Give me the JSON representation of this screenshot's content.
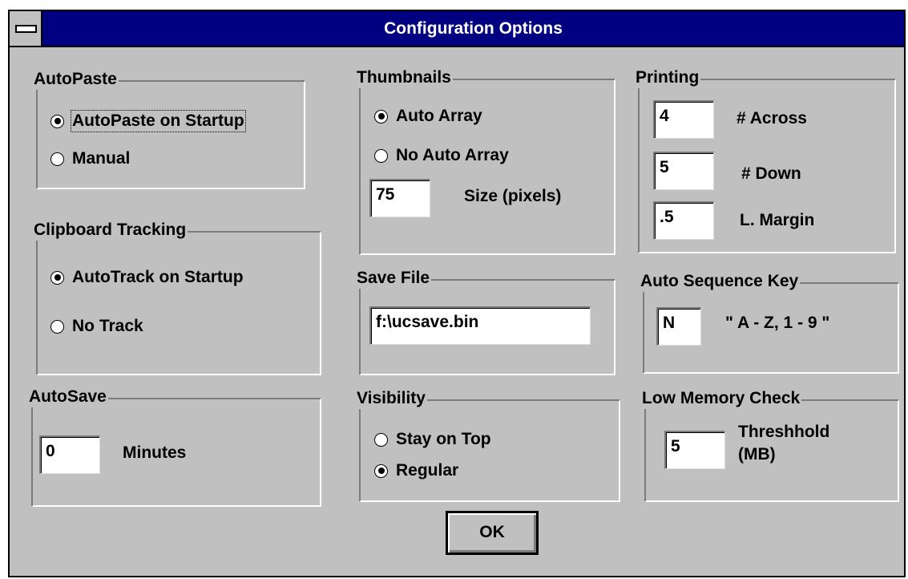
{
  "window": {
    "title": "Configuration Options"
  },
  "autopaste": {
    "legend": "AutoPaste",
    "options": [
      {
        "label": "AutoPaste on Startup",
        "selected": true
      },
      {
        "label": "Manual",
        "selected": false
      }
    ]
  },
  "clipboard": {
    "legend": "Clipboard Tracking",
    "options": [
      {
        "label": "AutoTrack on Startup",
        "selected": true
      },
      {
        "label": "No Track",
        "selected": false
      }
    ]
  },
  "autosave": {
    "legend": "AutoSave",
    "value": "0",
    "unit_label": "Minutes"
  },
  "thumbnails": {
    "legend": "Thumbnails",
    "options": [
      {
        "label": "Auto Array",
        "selected": true
      },
      {
        "label": "No Auto Array",
        "selected": false
      }
    ],
    "size_value": "75",
    "size_label": "Size (pixels)"
  },
  "savefile": {
    "legend": "Save File",
    "value": "f:\\ucsave.bin"
  },
  "visibility": {
    "legend": "Visibility",
    "options": [
      {
        "label": "Stay on Top",
        "selected": false
      },
      {
        "label": "Regular",
        "selected": true
      }
    ]
  },
  "printing": {
    "legend": "Printing",
    "across_value": "4",
    "across_label": "# Across",
    "down_value": "5",
    "down_label": "# Down",
    "margin_value": ".5",
    "margin_label": "L. Margin"
  },
  "sequence": {
    "legend": "Auto Sequence Key",
    "value": "N",
    "hint": "\" A - Z, 1 - 9 \""
  },
  "lowmem": {
    "legend": "Low Memory Check",
    "value": "5",
    "label_line1": "Threshhold",
    "label_line2": "(MB)"
  },
  "ok_label": "OK"
}
